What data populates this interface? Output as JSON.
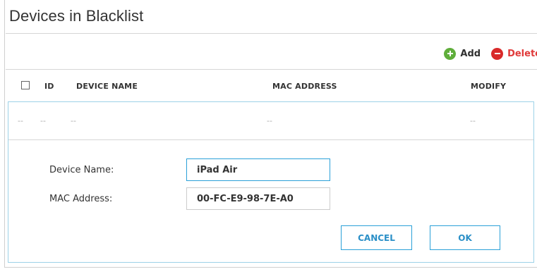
{
  "page": {
    "title": "Devices in Blacklist"
  },
  "toolbar": {
    "add_label": "Add",
    "delete_label": "Delete",
    "add_icon": "plus-circle-icon",
    "delete_icon": "minus-circle-icon",
    "add_color": "#5fae3b",
    "delete_color": "#d92a2a"
  },
  "table": {
    "columns": [
      "ID",
      "DEVICE NAME",
      "MAC ADDRESS",
      "MODIFY"
    ],
    "empty_row": {
      "check": "--",
      "id": "--",
      "device_name": "--",
      "mac_address": "--",
      "modify": "--"
    }
  },
  "form": {
    "device_name_label": "Device Name:",
    "device_name_value": "iPad Air",
    "mac_address_label": "MAC Address:",
    "mac_address_value": "00-FC-E9-98-7E-A0",
    "cancel_label": "CANCEL",
    "ok_label": "OK"
  },
  "colors": {
    "accent": "#2aa0d8",
    "text": "#333333"
  }
}
